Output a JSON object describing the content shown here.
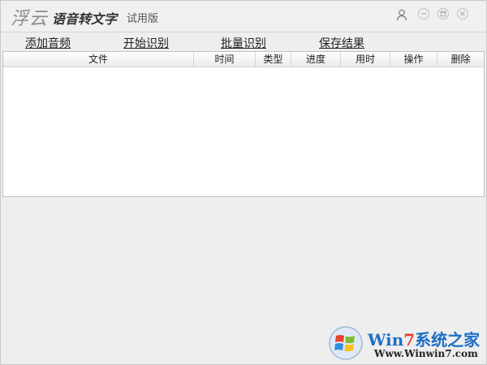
{
  "app": {
    "logo_text": "浮云",
    "name": "语音转文字",
    "edition": "试用版"
  },
  "titlebar": {
    "user_icon": "user-icon",
    "minimize_icon": "minimize-icon",
    "maximize_icon": "maximize-icon",
    "close_icon": "close-icon"
  },
  "menu": {
    "items": [
      {
        "label": "添加音频"
      },
      {
        "label": "开始识别"
      },
      {
        "label": "批量识别"
      },
      {
        "label": "保存结果"
      }
    ]
  },
  "table": {
    "columns": [
      "文件",
      "时间",
      "类型",
      "进度",
      "用时",
      "操作",
      "删除"
    ],
    "rows": []
  },
  "watermark": {
    "brand_win": "Win",
    "brand_7": "7",
    "brand_rest": "系统之家",
    "url": "Www.Winwin7.com"
  },
  "colors": {
    "accent": "#1e6fc4",
    "background": "#eeeeee",
    "table_border": "#b8c4d0"
  }
}
